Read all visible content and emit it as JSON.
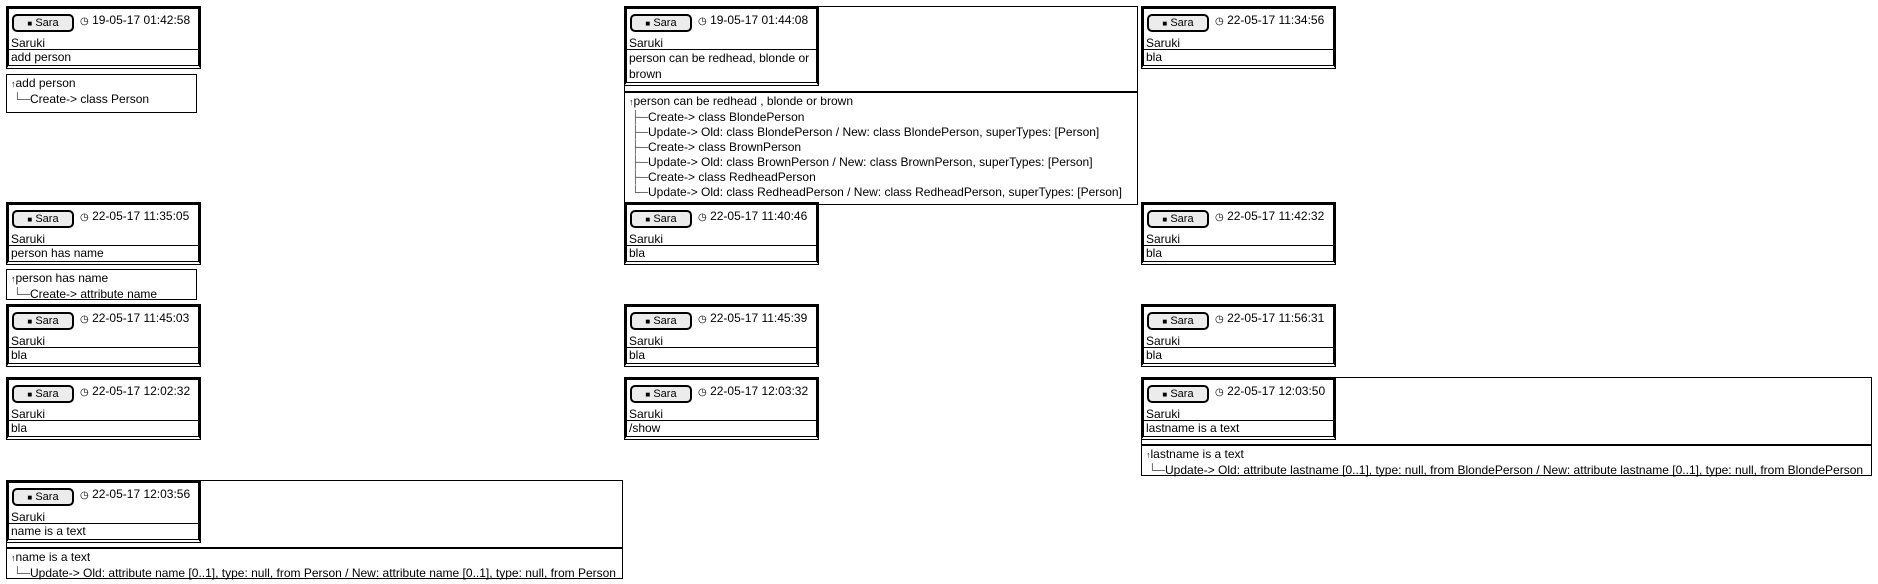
{
  "commits": [
    {
      "user": "Sara",
      "timestamp": "19-05-17 01:42:58",
      "author": "Saruki",
      "message": "add person",
      "log": {
        "title": "add person",
        "lines": [
          "Create-> class Person"
        ]
      }
    },
    {
      "user": "Sara",
      "timestamp": "19-05-17 01:44:08",
      "author": "Saruki",
      "message": "person can be redhead, blonde or brown",
      "log": {
        "title": "person can be redhead , blonde or brown",
        "lines": [
          "Create-> class BlondePerson",
          "Update-> Old: class BlondePerson / New: class BlondePerson, superTypes: [Person]",
          "Create-> class BrownPerson",
          "Update-> Old: class BrownPerson / New: class BrownPerson, superTypes: [Person]",
          "Create-> class RedheadPerson",
          "Update-> Old: class RedheadPerson / New: class RedheadPerson, superTypes: [Person]"
        ]
      }
    },
    {
      "user": "Sara",
      "timestamp": "22-05-17 11:34:56",
      "author": "Saruki",
      "message": "bla"
    },
    {
      "user": "Sara",
      "timestamp": "22-05-17 11:35:05",
      "author": "Saruki",
      "message": "person has name",
      "log": {
        "title": "person has name",
        "lines": [
          "Create-> attribute name"
        ]
      }
    },
    {
      "user": "Sara",
      "timestamp": "22-05-17 11:40:46",
      "author": "Saruki",
      "message": "bla"
    },
    {
      "user": "Sara",
      "timestamp": "22-05-17 11:42:32",
      "author": "Saruki",
      "message": "bla"
    },
    {
      "user": "Sara",
      "timestamp": "22-05-17 11:45:03",
      "author": "Saruki",
      "message": "bla"
    },
    {
      "user": "Sara",
      "timestamp": "22-05-17 11:45:39",
      "author": "Saruki",
      "message": "bla"
    },
    {
      "user": "Sara",
      "timestamp": "22-05-17 11:56:31",
      "author": "Saruki",
      "message": "bla"
    },
    {
      "user": "Sara",
      "timestamp": "22-05-17 12:02:32",
      "author": "Saruki",
      "message": "bla"
    },
    {
      "user": "Sara",
      "timestamp": "22-05-17 12:03:32",
      "author": "Saruki",
      "message": "/show"
    },
    {
      "user": "Sara",
      "timestamp": "22-05-17 12:03:50",
      "author": "Saruki",
      "message": "lastname is a text",
      "log": {
        "title": "lastname is a text",
        "lines": [
          "Update-> Old: attribute lastname [0..1], type: null, from BlondePerson / New: attribute lastname [0..1], type: null, from BlondePerson"
        ]
      }
    },
    {
      "user": "Sara",
      "timestamp": "22-05-17 12:03:56",
      "author": "Saruki",
      "message": "name is a text",
      "log": {
        "title": "name is a text",
        "lines": [
          "Update-> Old: attribute name [0..1], type: null, from Person / New: attribute name [0..1], type: null, from Person"
        ]
      }
    }
  ],
  "icons": {
    "user": "user-icon",
    "clock": "clock-icon"
  }
}
